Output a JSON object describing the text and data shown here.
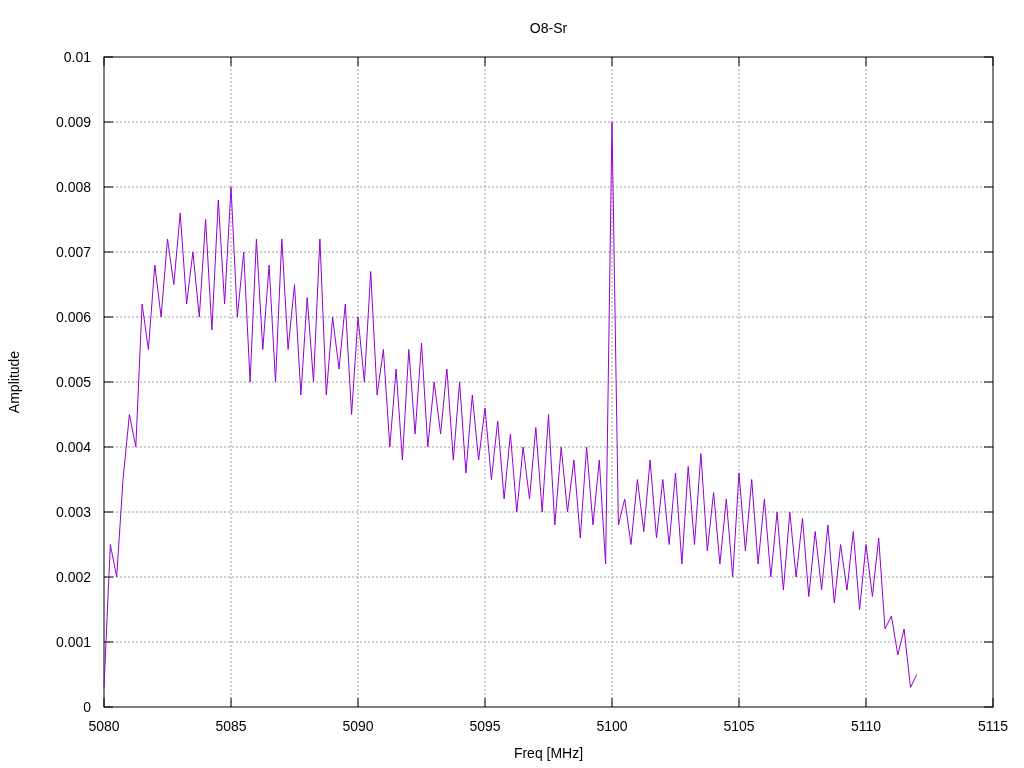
{
  "chart": {
    "chart_data": {
      "type": "line",
      "title": "O8-Sr",
      "xlabel": "Freq [MHz]",
      "ylabel": "Amplitude",
      "grid": true,
      "xlim": [
        5080,
        5115
      ],
      "ylim": [
        0,
        0.01
      ],
      "xticks": [
        5080,
        5085,
        5090,
        5095,
        5100,
        5105,
        5110,
        5115
      ],
      "yticks": [
        {
          "value": 0,
          "label": "0"
        },
        {
          "value": 0.001,
          "label": "0.001"
        },
        {
          "value": 0.002,
          "label": "0.002"
        },
        {
          "value": 0.003,
          "label": "0.003"
        },
        {
          "value": 0.004,
          "label": "0.004"
        },
        {
          "value": 0.005,
          "label": "0.005"
        },
        {
          "value": 0.006,
          "label": "0.006"
        },
        {
          "value": 0.007,
          "label": "0.007"
        },
        {
          "value": 0.008,
          "label": "0.008"
        },
        {
          "value": 0.009,
          "label": "0.009"
        },
        {
          "value": 0.01,
          "label": "0.01"
        }
      ],
      "x": [
        5080,
        5080.25,
        5080.5,
        5080.75,
        5081,
        5081.25,
        5081.5,
        5081.75,
        5082,
        5082.25,
        5082.5,
        5082.75,
        5083,
        5083.25,
        5083.5,
        5083.75,
        5084,
        5084.25,
        5084.5,
        5084.75,
        5085,
        5085.25,
        5085.5,
        5085.75,
        5086,
        5086.25,
        5086.5,
        5086.75,
        5087,
        5087.25,
        5087.5,
        5087.75,
        5088,
        5088.25,
        5088.5,
        5088.75,
        5089,
        5089.25,
        5089.5,
        5089.75,
        5090,
        5090.25,
        5090.5,
        5090.75,
        5091,
        5091.25,
        5091.5,
        5091.75,
        5092,
        5092.25,
        5092.5,
        5092.75,
        5093,
        5093.25,
        5093.5,
        5093.75,
        5094,
        5094.25,
        5094.5,
        5094.75,
        5095,
        5095.25,
        5095.5,
        5095.75,
        5096,
        5096.25,
        5096.5,
        5096.75,
        5097,
        5097.25,
        5097.5,
        5097.75,
        5098,
        5098.25,
        5098.5,
        5098.75,
        5099,
        5099.25,
        5099.5,
        5099.75,
        5100,
        5100.25,
        5100.5,
        5100.75,
        5101,
        5101.25,
        5101.5,
        5101.75,
        5102,
        5102.25,
        5102.5,
        5102.75,
        5103,
        5103.25,
        5103.5,
        5103.75,
        5104,
        5104.25,
        5104.5,
        5104.75,
        5105,
        5105.25,
        5105.5,
        5105.75,
        5106,
        5106.25,
        5106.5,
        5106.75,
        5107,
        5107.25,
        5107.5,
        5107.75,
        5108,
        5108.25,
        5108.5,
        5108.75,
        5109,
        5109.25,
        5109.5,
        5109.75,
        5110,
        5110.25,
        5110.5,
        5110.75,
        5111,
        5111.25,
        5111.5,
        5111.75,
        5112
      ],
      "series": [
        {
          "color": "#9400d3",
          "values": [
            0.0003,
            0.0025,
            0.002,
            0.0035,
            0.0045,
            0.004,
            0.0062,
            0.0055,
            0.0068,
            0.006,
            0.0072,
            0.0065,
            0.0076,
            0.0062,
            0.007,
            0.006,
            0.0075,
            0.0058,
            0.0078,
            0.0062,
            0.008,
            0.006,
            0.007,
            0.005,
            0.0072,
            0.0055,
            0.0068,
            0.005,
            0.0072,
            0.0055,
            0.0065,
            0.0048,
            0.0063,
            0.005,
            0.0072,
            0.0048,
            0.006,
            0.0052,
            0.0062,
            0.0045,
            0.006,
            0.005,
            0.0067,
            0.0048,
            0.0055,
            0.004,
            0.0052,
            0.0038,
            0.0055,
            0.0042,
            0.0056,
            0.004,
            0.005,
            0.0042,
            0.0052,
            0.0038,
            0.005,
            0.0036,
            0.0048,
            0.0038,
            0.0046,
            0.0035,
            0.0044,
            0.0032,
            0.0042,
            0.003,
            0.004,
            0.0032,
            0.0043,
            0.003,
            0.0045,
            0.0028,
            0.004,
            0.003,
            0.0038,
            0.0026,
            0.004,
            0.0028,
            0.0038,
            0.0022,
            0.009,
            0.0028,
            0.0032,
            0.0025,
            0.0035,
            0.0027,
            0.0038,
            0.0026,
            0.0035,
            0.0025,
            0.0036,
            0.0022,
            0.0037,
            0.0025,
            0.0039,
            0.0024,
            0.0033,
            0.0022,
            0.0032,
            0.002,
            0.0036,
            0.0024,
            0.0035,
            0.0022,
            0.0032,
            0.002,
            0.003,
            0.0018,
            0.003,
            0.002,
            0.0029,
            0.0017,
            0.0027,
            0.0018,
            0.0028,
            0.0016,
            0.0025,
            0.0018,
            0.0027,
            0.0015,
            0.0025,
            0.0017,
            0.0026,
            0.0012,
            0.0014,
            0.0008,
            0.0012,
            0.0003,
            0.0005
          ]
        }
      ]
    }
  }
}
